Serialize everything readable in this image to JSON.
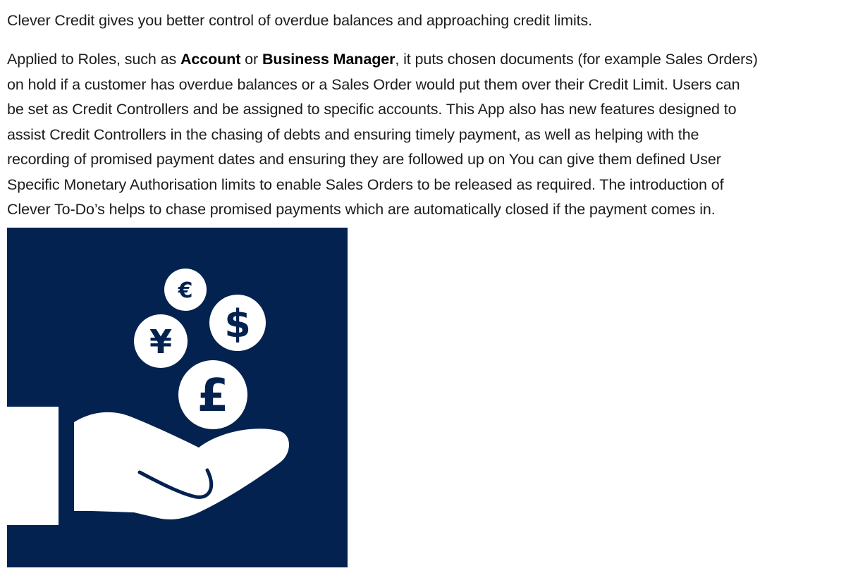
{
  "intro": "Clever Credit gives you better control of overdue balances and approaching credit limits.",
  "description": {
    "l1_before": "Applied to Roles, such as ",
    "role_1": "Account",
    "l1_or": " or ",
    "role_2": "Business Manager",
    "l1_after": ", it puts chosen documents (for example Sales Orders)",
    "l2": "on hold if a customer has overdue balances or a Sales Order would put them over their Credit Limit. Users can",
    "l3": "be set as Credit Controllers and be assigned to specific accounts. This App also has new features designed to",
    "l4": "assist Credit Controllers in the chasing of debts and ensuring timely payment, as well as helping with the",
    "l5": "recording of promised payment dates and ensuring they are followed up on You can give them defined User",
    "l6": "Specific Monetary Authorisation limits to enable Sales Orders to be released as required. The introduction of",
    "l7": "Clever To-Do’s helps to chase promised payments which are automatically closed if the payment comes in."
  },
  "illustration": {
    "background_color": "#03224f",
    "foreground_color": "#ffffff",
    "coins": {
      "euro": "€",
      "dollar": "$",
      "yen": "¥",
      "pound": "£"
    },
    "icons": [
      "euro-coin-icon",
      "dollar-coin-icon",
      "yen-coin-icon",
      "pound-coin-icon",
      "open-hand-icon",
      "sleeve-icon"
    ]
  }
}
